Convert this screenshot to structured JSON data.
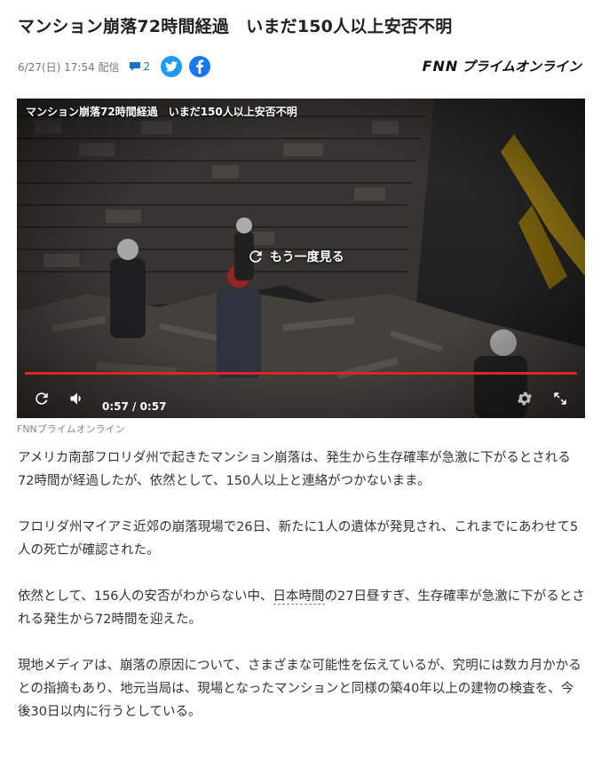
{
  "article": {
    "title": "マンション崩落72時間経過　いまだ150人以上安否不明",
    "date": "6/27(日) 17:54 配信",
    "comment_count": "2",
    "provider": {
      "brand": "FNN",
      "name": "プライムオンライン"
    }
  },
  "video": {
    "overlay_title": "マンション崩落72時間経過　いまだ150人以上安否不明",
    "replay_label": "もう一度見る",
    "time_display": "0:57 / 0:57",
    "progress_fraction": 1.0,
    "caption": "FNNプライムオンライン"
  },
  "body": {
    "p1": "アメリカ南部フロリダ州で起きたマンション崩落は、発生から生存確率が急激に下がるとされる72時間が経過したが、依然として、150人以上と連絡がつかないまま。",
    "p2": "フロリダ州マイアミ近郊の崩落現場で26日、新たに1人の遺体が発見され、これまでにあわせて5人の死亡が確認された。",
    "p3_before": "依然として、156人の安否がわからない中、",
    "p3_link": "日本時間",
    "p3_after": "の27日昼すぎ、生存確率が急激に下がるとされる発生から72時間を迎えた。",
    "p4": "現地メディアは、崩落の原因について、さまざまな可能性を伝えているが、究明には数カ月かかるとの指摘もあり、地元当局は、現場となったマンションと同様の築40年以上の建物の検査を、今後30日以内に行うとしている。"
  },
  "colors": {
    "twitter": "#1d9bf0",
    "facebook": "#1877f2",
    "comment_blue": "#1a73c4",
    "progress_red": "#e02424"
  }
}
